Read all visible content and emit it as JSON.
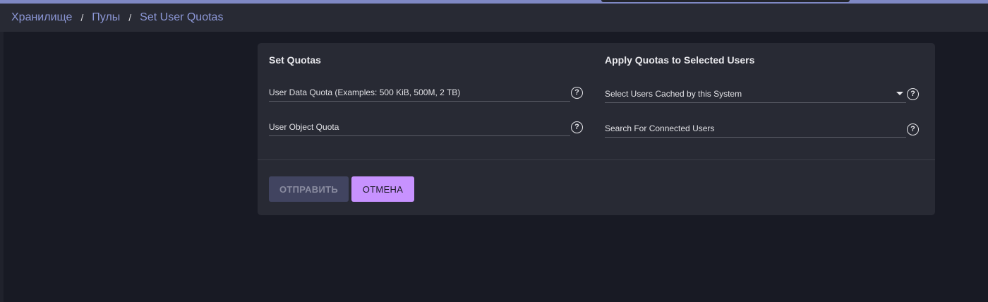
{
  "breadcrumb": {
    "items": [
      "Хранилище",
      "Пулы",
      "Set User Quotas"
    ],
    "separator": "/"
  },
  "set_quotas": {
    "title": "Set Quotas",
    "user_data_quota_label": "User Data Quota (Examples: 500 KiB, 500M, 2 TB)",
    "user_object_quota_label": "User Object Quota"
  },
  "apply_quotas": {
    "title": "Apply Quotas to Selected Users",
    "select_users_label": "Select Users Cached by this System",
    "search_users_label": "Search For Connected Users"
  },
  "help_glyph": "?",
  "buttons": {
    "submit_label": "ОТПРАВИТЬ",
    "cancel_label": "ОТМЕНА"
  },
  "colors": {
    "accent": "#c792ff",
    "link": "#8c97d6",
    "card_bg": "#282a34",
    "page_bg": "#181a24"
  },
  "icons": {
    "help": "help-circle-icon",
    "dropdown": "caret-down-icon"
  }
}
